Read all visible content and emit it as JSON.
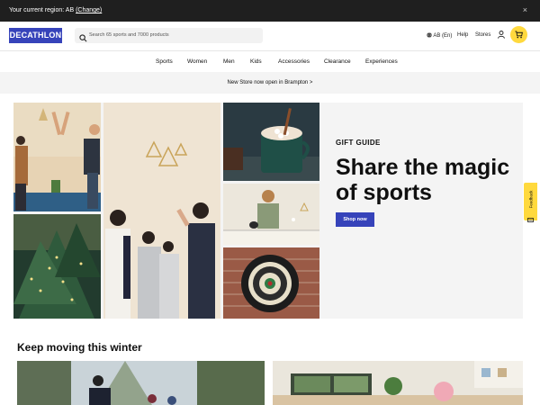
{
  "region_bar": {
    "message": "Your current region: AB",
    "change_link": "(Change)",
    "close": "×"
  },
  "header": {
    "logo": "DECATHLON",
    "search_placeholder": "Search 65 sports and 7000 products",
    "language": "AB (En)",
    "help": "Help",
    "stores": "Stores",
    "icons": [
      "search-icon",
      "globe-icon",
      "user-icon",
      "cart-icon"
    ]
  },
  "nav": {
    "items": [
      "Sports",
      "Women",
      "Men",
      "Kids",
      "Accessories",
      "Clearance",
      "Experiences"
    ]
  },
  "promo_banner": {
    "text": "New Store now open in Brampton >"
  },
  "hero": {
    "eyebrow": "GIFT GUIDE",
    "title": "Share the magic of sports",
    "cta": "Shop now"
  },
  "feedback_tab": {
    "label": "Feedback"
  },
  "section": {
    "title": "Keep moving this winter"
  },
  "colors": {
    "brand_blue": "#3643ba",
    "accent_yellow": "#ffd93d",
    "top_bar": "#1f1f1f",
    "promo_bg": "#f4f4f4"
  }
}
